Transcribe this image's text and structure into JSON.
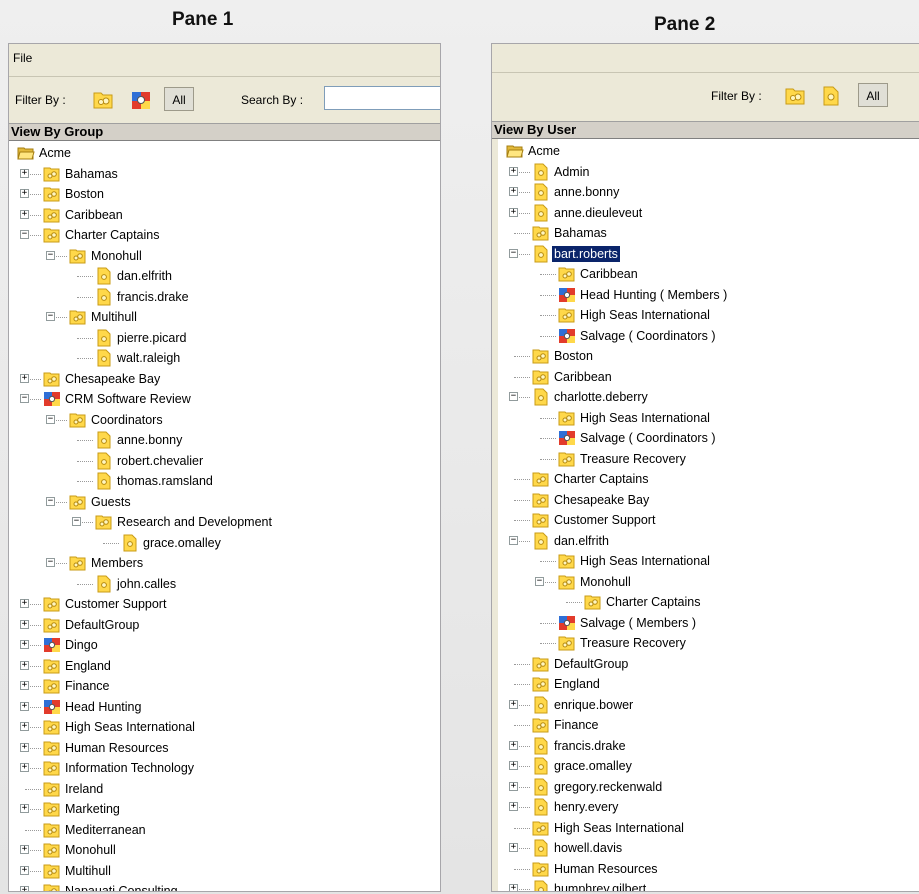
{
  "pane1": {
    "title": "Pane 1",
    "menu": {
      "file": "File"
    },
    "filter_label": "Filter By :",
    "all_label": "All",
    "search_label": "Search By :",
    "search_value": "",
    "tree_title": "View By Group",
    "tree": [
      {
        "label": "Acme",
        "icon": "open-folder",
        "depth": 0,
        "exp": "none"
      },
      {
        "label": "Bahamas",
        "icon": "group",
        "depth": 1,
        "exp": "+"
      },
      {
        "label": "Boston",
        "icon": "group",
        "depth": 1,
        "exp": "+"
      },
      {
        "label": "Caribbean",
        "icon": "group",
        "depth": 1,
        "exp": "+"
      },
      {
        "label": "Charter Captains",
        "icon": "group",
        "depth": 1,
        "exp": "-"
      },
      {
        "label": "Monohull",
        "icon": "group",
        "depth": 2,
        "exp": "-"
      },
      {
        "label": "dan.elfrith",
        "icon": "user",
        "depth": 3,
        "exp": "none"
      },
      {
        "label": "francis.drake",
        "icon": "user",
        "depth": 3,
        "exp": "none"
      },
      {
        "label": "Multihull",
        "icon": "group",
        "depth": 2,
        "exp": "-"
      },
      {
        "label": "pierre.picard",
        "icon": "user",
        "depth": 3,
        "exp": "none"
      },
      {
        "label": "walt.raleigh",
        "icon": "user",
        "depth": 3,
        "exp": "none"
      },
      {
        "label": "Chesapeake Bay",
        "icon": "group",
        "depth": 1,
        "exp": "+"
      },
      {
        "label": "CRM Software Review",
        "icon": "project",
        "depth": 1,
        "exp": "-"
      },
      {
        "label": "Coordinators",
        "icon": "group",
        "depth": 2,
        "exp": "-"
      },
      {
        "label": "anne.bonny",
        "icon": "user",
        "depth": 3,
        "exp": "none"
      },
      {
        "label": "robert.chevalier",
        "icon": "user",
        "depth": 3,
        "exp": "none"
      },
      {
        "label": "thomas.ramsland",
        "icon": "user",
        "depth": 3,
        "exp": "none"
      },
      {
        "label": "Guests",
        "icon": "group",
        "depth": 2,
        "exp": "-"
      },
      {
        "label": "Research and Development",
        "icon": "group",
        "depth": 3,
        "exp": "-"
      },
      {
        "label": "grace.omalley",
        "icon": "user",
        "depth": 4,
        "exp": "none"
      },
      {
        "label": "Members",
        "icon": "group",
        "depth": 2,
        "exp": "-"
      },
      {
        "label": "john.calles",
        "icon": "user",
        "depth": 3,
        "exp": "none"
      },
      {
        "label": "Customer Support",
        "icon": "group",
        "depth": 1,
        "exp": "+"
      },
      {
        "label": "DefaultGroup",
        "icon": "group",
        "depth": 1,
        "exp": "+"
      },
      {
        "label": "Dingo",
        "icon": "project",
        "depth": 1,
        "exp": "+"
      },
      {
        "label": "England",
        "icon": "group",
        "depth": 1,
        "exp": "+"
      },
      {
        "label": "Finance",
        "icon": "group",
        "depth": 1,
        "exp": "+"
      },
      {
        "label": "Head Hunting",
        "icon": "project",
        "depth": 1,
        "exp": "+"
      },
      {
        "label": "High Seas International",
        "icon": "group",
        "depth": 1,
        "exp": "+"
      },
      {
        "label": "Human Resources",
        "icon": "group",
        "depth": 1,
        "exp": "+"
      },
      {
        "label": "Information Technology",
        "icon": "group",
        "depth": 1,
        "exp": "+"
      },
      {
        "label": "Ireland",
        "icon": "group",
        "depth": 1,
        "exp": "none"
      },
      {
        "label": "Marketing",
        "icon": "group",
        "depth": 1,
        "exp": "+"
      },
      {
        "label": "Mediterranean",
        "icon": "group",
        "depth": 1,
        "exp": "none"
      },
      {
        "label": "Monohull",
        "icon": "group",
        "depth": 1,
        "exp": "+"
      },
      {
        "label": "Multihull",
        "icon": "group",
        "depth": 1,
        "exp": "+"
      },
      {
        "label": "Napauati Consulting",
        "icon": "group",
        "depth": 1,
        "exp": "+"
      }
    ]
  },
  "pane2": {
    "title": "Pane 2",
    "filter_label": "Filter By :",
    "all_label": "All",
    "tree_title": "View By User",
    "tree": [
      {
        "label": "Acme",
        "icon": "open-folder",
        "depth": 0,
        "exp": "none"
      },
      {
        "label": "Admin",
        "icon": "user",
        "depth": 1,
        "exp": "+"
      },
      {
        "label": "anne.bonny",
        "icon": "user",
        "depth": 1,
        "exp": "+"
      },
      {
        "label": "anne.dieuleveut",
        "icon": "user",
        "depth": 1,
        "exp": "+"
      },
      {
        "label": "Bahamas",
        "icon": "group",
        "depth": 1,
        "exp": "none"
      },
      {
        "label": "bart.roberts",
        "icon": "user",
        "depth": 1,
        "exp": "-",
        "selected": true
      },
      {
        "label": "Caribbean",
        "icon": "group",
        "depth": 2,
        "exp": "none"
      },
      {
        "label": "Head Hunting ( Members )",
        "icon": "project",
        "depth": 2,
        "exp": "none"
      },
      {
        "label": "High Seas International",
        "icon": "group",
        "depth": 2,
        "exp": "none"
      },
      {
        "label": "Salvage ( Coordinators )",
        "icon": "project",
        "depth": 2,
        "exp": "none"
      },
      {
        "label": "Boston",
        "icon": "group",
        "depth": 1,
        "exp": "none"
      },
      {
        "label": "Caribbean",
        "icon": "group",
        "depth": 1,
        "exp": "none"
      },
      {
        "label": "charlotte.deberry",
        "icon": "user",
        "depth": 1,
        "exp": "-"
      },
      {
        "label": "High Seas International",
        "icon": "group",
        "depth": 2,
        "exp": "none"
      },
      {
        "label": "Salvage ( Coordinators )",
        "icon": "project",
        "depth": 2,
        "exp": "none"
      },
      {
        "label": "Treasure Recovery",
        "icon": "group",
        "depth": 2,
        "exp": "none"
      },
      {
        "label": "Charter Captains",
        "icon": "group",
        "depth": 1,
        "exp": "none"
      },
      {
        "label": "Chesapeake Bay",
        "icon": "group",
        "depth": 1,
        "exp": "none"
      },
      {
        "label": "Customer Support",
        "icon": "group",
        "depth": 1,
        "exp": "none"
      },
      {
        "label": "dan.elfrith",
        "icon": "user",
        "depth": 1,
        "exp": "-"
      },
      {
        "label": "High Seas International",
        "icon": "group",
        "depth": 2,
        "exp": "none"
      },
      {
        "label": "Monohull",
        "icon": "group",
        "depth": 2,
        "exp": "-"
      },
      {
        "label": "Charter Captains",
        "icon": "group",
        "depth": 3,
        "exp": "none"
      },
      {
        "label": "Salvage ( Members )",
        "icon": "project",
        "depth": 2,
        "exp": "none"
      },
      {
        "label": "Treasure Recovery",
        "icon": "group",
        "depth": 2,
        "exp": "none"
      },
      {
        "label": "DefaultGroup",
        "icon": "group",
        "depth": 1,
        "exp": "none"
      },
      {
        "label": "England",
        "icon": "group",
        "depth": 1,
        "exp": "none"
      },
      {
        "label": "enrique.bower",
        "icon": "user",
        "depth": 1,
        "exp": "+"
      },
      {
        "label": "Finance",
        "icon": "group",
        "depth": 1,
        "exp": "none"
      },
      {
        "label": "francis.drake",
        "icon": "user",
        "depth": 1,
        "exp": "+"
      },
      {
        "label": "grace.omalley",
        "icon": "user",
        "depth": 1,
        "exp": "+"
      },
      {
        "label": "gregory.reckenwald",
        "icon": "user",
        "depth": 1,
        "exp": "+"
      },
      {
        "label": "henry.every",
        "icon": "user",
        "depth": 1,
        "exp": "+"
      },
      {
        "label": "High Seas International",
        "icon": "group",
        "depth": 1,
        "exp": "none"
      },
      {
        "label": "howell.davis",
        "icon": "user",
        "depth": 1,
        "exp": "+"
      },
      {
        "label": "Human Resources",
        "icon": "group",
        "depth": 1,
        "exp": "none"
      },
      {
        "label": "humphrey.gilbert",
        "icon": "user",
        "depth": 1,
        "exp": "+"
      }
    ]
  },
  "colors": {
    "selection": "#0a246a",
    "window_bg": "#ece9d8",
    "folder_yellow": "#ffd84a",
    "project_blue": "#2f6fd6",
    "project_red": "#e23b2b"
  }
}
